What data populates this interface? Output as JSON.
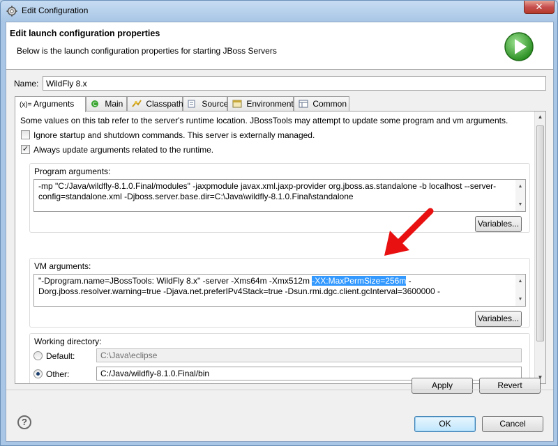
{
  "window": {
    "title": "Edit Configuration",
    "close_glyph": "✕"
  },
  "header": {
    "title": "Edit launch configuration properties",
    "description": "Below is the launch configuration properties for starting JBoss Servers",
    "icon": "run-icon"
  },
  "name_field": {
    "label": "Name:",
    "value": "WildFly 8.x"
  },
  "tabs": [
    {
      "label": "Arguments",
      "icon_text": "(x)=",
      "active": true
    },
    {
      "label": "Main",
      "icon": "main-icon"
    },
    {
      "label": "Classpath",
      "icon": "classpath-icon"
    },
    {
      "label": "Source",
      "icon": "source-icon"
    },
    {
      "label": "Environment",
      "icon": "environment-icon"
    },
    {
      "label": "Common",
      "icon": "common-icon"
    }
  ],
  "arguments": {
    "info": "Some values on this tab refer to the server's runtime location. JBossTools may attempt to update some program and vm arguments.",
    "ignore_startup": {
      "label": "Ignore startup and shutdown commands. This server is externally managed.",
      "checked": false
    },
    "always_update": {
      "label": "Always update arguments related to the runtime.",
      "checked": true
    },
    "program": {
      "label": "Program arguments:",
      "line1": "-mp \"C:/Java/wildfly-8.1.0.Final/modules\" -jaxpmodule javax.xml.jaxp-provider org.jboss.as.standalone -b localhost --server-",
      "line2": "config=standalone.xml -Djboss.server.base.dir=C:\\Java\\wildfly-8.1.0.Final\\standalone",
      "variables_label": "Variables..."
    },
    "vm": {
      "label": "VM arguments:",
      "line1_before": "\"-Dprogram.name=JBossTools: WildFly 8.x\" -server -Xms64m -Xmx512m ",
      "line1_selected": "-XX:MaxPermSize=256m",
      "line1_after": " -",
      "line2": "Dorg.jboss.resolver.warning=true -Djava.net.preferIPv4Stack=true -Dsun.rmi.dgc.client.gcInterval=3600000 -",
      "variables_label": "Variables..."
    },
    "working_dir": {
      "label": "Working directory:",
      "default_label": "Default:",
      "default_value": "C:\\Java\\eclipse",
      "other_label": "Other:",
      "other_value": "C:/Java/wildfly-8.1.0.Final/bin",
      "selected": "other"
    }
  },
  "actions": {
    "apply": "Apply",
    "revert": "Revert",
    "ok": "OK",
    "cancel": "Cancel",
    "help_glyph": "?"
  },
  "colors": {
    "selection": "#3399ff",
    "annotation_arrow": "#e81010",
    "play_green": "#3aa531"
  }
}
